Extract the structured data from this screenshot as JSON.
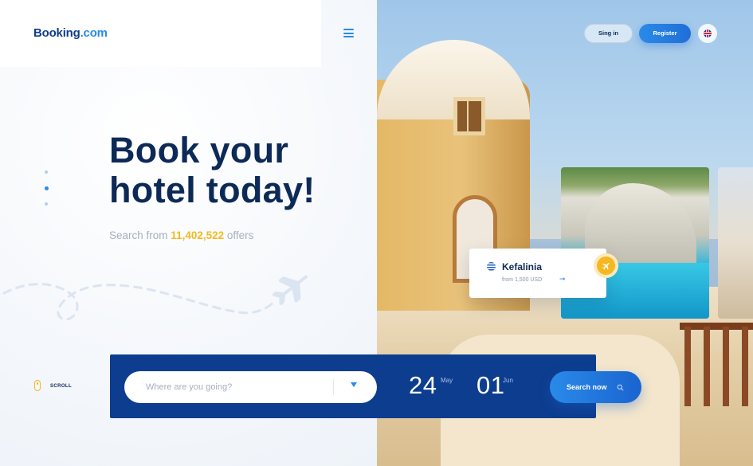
{
  "brand": {
    "name": "Booking",
    "tld": ".com"
  },
  "nav": {
    "signin_label": "Sing in",
    "register_label": "Register",
    "language": "uk-flag-icon"
  },
  "hero": {
    "headline_line1": "Book your",
    "headline_line2": "hotel today!",
    "sub_prefix": "Search from",
    "offers_count": "11,402,522",
    "sub_suffix": "offers"
  },
  "scroll": {
    "label": "SCROLL"
  },
  "slider": {
    "count": 3,
    "active_index": 1
  },
  "destination_card": {
    "name": "Kefalinia",
    "price": "from 1,500 USD",
    "flag": "greece-flag-icon"
  },
  "search": {
    "placeholder": "Where are you going?",
    "checkin_day": "24",
    "checkin_month": "May",
    "checkout_day": "01",
    "checkout_month": "Jun",
    "button_label": "Search now"
  },
  "colors": {
    "primary_dark": "#0d3d8f",
    "accent_blue": "#2a8ae8",
    "accent_yellow": "#f5b821",
    "heading": "#0d2a57",
    "muted": "#a6b0c0"
  }
}
